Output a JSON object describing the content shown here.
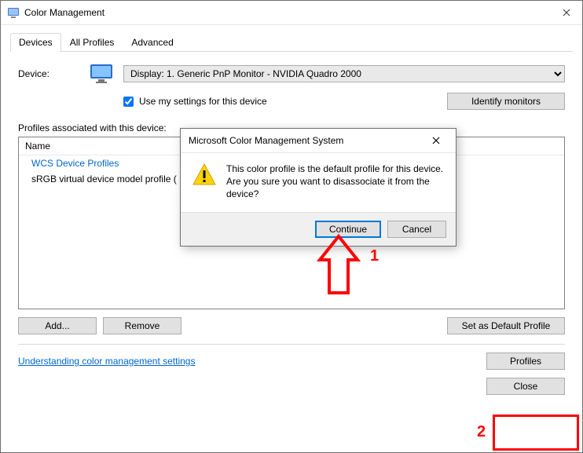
{
  "window": {
    "title": "Color Management"
  },
  "tabs": {
    "devices": "Devices",
    "all": "All Profiles",
    "advanced": "Advanced"
  },
  "device": {
    "label": "Device:",
    "selected": "Display: 1. Generic PnP Monitor - NVIDIA Quadro 2000",
    "use_my_settings": "Use my settings for this device",
    "identify": "Identify monitors"
  },
  "profiles": {
    "label": "Profiles associated with this device:",
    "col_name": "Name",
    "group": "WCS Device Profiles",
    "item": "sRGB virtual device model profile (",
    "add": "Add...",
    "remove": "Remove",
    "set_default": "Set as Default Profile"
  },
  "footer": {
    "link": "Understanding color management settings",
    "profiles_btn": "Profiles",
    "close": "Close"
  },
  "dialog": {
    "title": "Microsoft Color Management System",
    "message": "This color profile is the default profile for this device. Are you sure you want to disassociate it from the device?",
    "continue": "Continue",
    "cancel": "Cancel"
  },
  "annotations": {
    "one": "1",
    "two": "2"
  }
}
